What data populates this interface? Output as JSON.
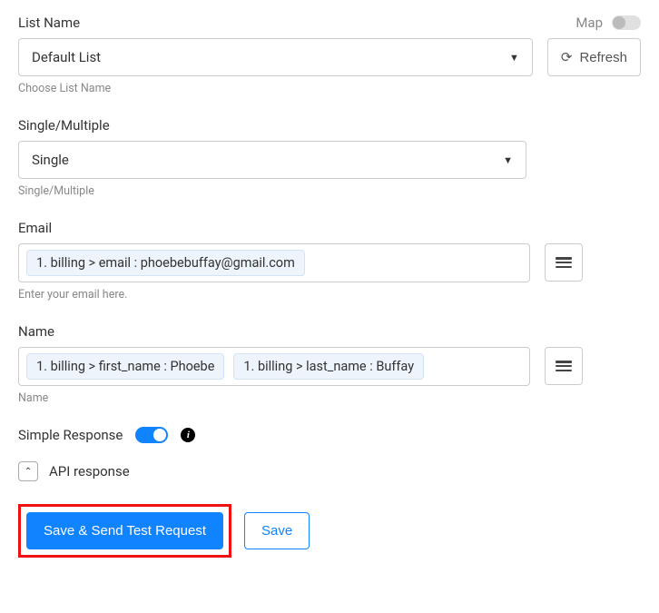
{
  "listName": {
    "label": "List Name",
    "mapLabel": "Map",
    "value": "Default List",
    "refresh": "Refresh",
    "helper": "Choose List Name"
  },
  "singleMultiple": {
    "label": "Single/Multiple",
    "value": "Single",
    "helper": "Single/Multiple"
  },
  "email": {
    "label": "Email",
    "token1": "1. billing > email : phoebebuffay@gmail.com",
    "helper": "Enter your email here."
  },
  "name": {
    "label": "Name",
    "token1": "1. billing > first_name : Phoebe",
    "token2": "1. billing > last_name : Buffay",
    "helper": "Name"
  },
  "simpleResponse": {
    "label": "Simple Response"
  },
  "apiResponse": {
    "label": "API response"
  },
  "buttons": {
    "saveAndSend": "Save & Send Test Request",
    "save": "Save"
  }
}
